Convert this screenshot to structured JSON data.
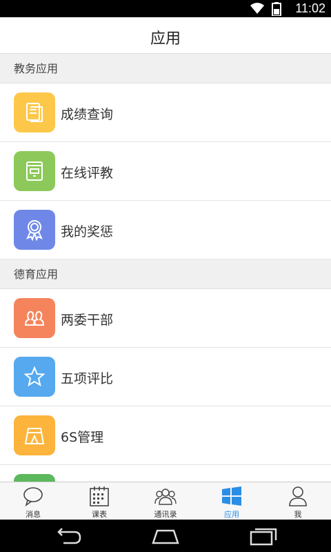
{
  "status": {
    "time": "11:02"
  },
  "header": {
    "title": "应用"
  },
  "sections": [
    {
      "title": "教务应用",
      "items": [
        {
          "label": "成绩查询",
          "icon": "document-icon",
          "color": "#fdc84a"
        },
        {
          "label": "在线评教",
          "icon": "book-icon",
          "color": "#8dc95a"
        },
        {
          "label": "我的奖惩",
          "icon": "award-ribbon-icon",
          "color": "#6f88e8"
        }
      ]
    },
    {
      "title": "德育应用",
      "items": [
        {
          "label": "两委干部",
          "icon": "group-people-icon",
          "color": "#f5845c"
        },
        {
          "label": "五项评比",
          "icon": "star-icon",
          "color": "#56a9ee"
        },
        {
          "label": "6S管理",
          "icon": "tent-icon",
          "color": "#fcb43c"
        }
      ]
    }
  ],
  "tabs": [
    {
      "label": "消息",
      "icon": "chat-bubble-icon"
    },
    {
      "label": "课表",
      "icon": "calendar-icon"
    },
    {
      "label": "通讯录",
      "icon": "contacts-icon"
    },
    {
      "label": "应用",
      "icon": "windows-grid-icon",
      "active": true
    },
    {
      "label": "我",
      "icon": "person-icon"
    }
  ],
  "colors": {
    "active_tab": "#2a8ee6",
    "partial_item": "#5cb85c"
  }
}
